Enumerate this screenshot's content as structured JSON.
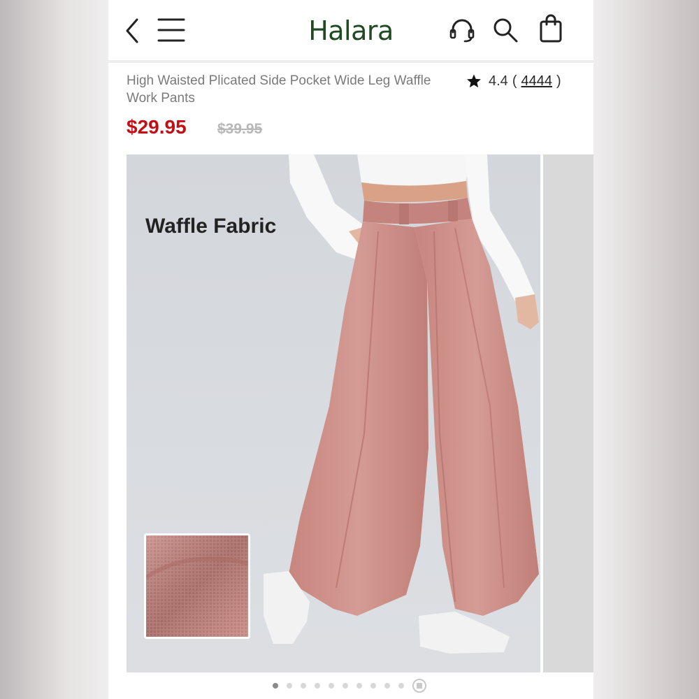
{
  "header": {
    "brand": "Halara",
    "brand_color": "#1f4a22",
    "icons": [
      "back-icon",
      "menu-icon",
      "customer-support-icon",
      "search-icon",
      "shopping-bag-icon"
    ]
  },
  "product": {
    "title": "High Waisted Plicated Side Pocket Wide Leg Waffle Work Pants",
    "rating": "4.4",
    "review_count": "4444",
    "paren_open": "(",
    "paren_close": ")",
    "price": "$29.95",
    "original_price": "$39.95",
    "price_color": "#c20f16"
  },
  "gallery": {
    "overlay_label": "Waffle Fabric",
    "dots_total": 10,
    "active_dot": 1,
    "pants_color": "#cf938c"
  }
}
